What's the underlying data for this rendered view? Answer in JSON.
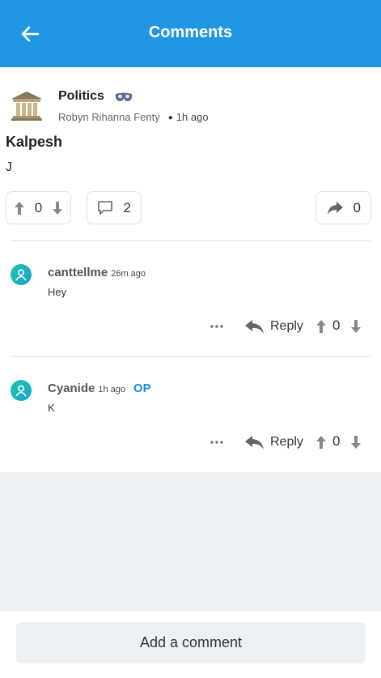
{
  "appbar": {
    "title": "Comments",
    "background": "#2196e3"
  },
  "post": {
    "community": "Politics",
    "author": "Robyn Rihanna Fenty",
    "time": "1h ago",
    "title": "Kalpesh",
    "body": "J",
    "score": "0",
    "comment_count": "2",
    "share_count": "0"
  },
  "comments": [
    {
      "author": "canttellme",
      "time": "26m ago",
      "text": "Hey",
      "is_op": false,
      "reply_label": "Reply",
      "score": "0"
    },
    {
      "author": "Cyanide",
      "time": "1h ago",
      "text": "K",
      "is_op": true,
      "op_label": "OP",
      "reply_label": "Reply",
      "score": "0"
    }
  ],
  "bottom": {
    "add_comment_label": "Add a comment"
  },
  "icons": {
    "back": "arrow-left-icon",
    "community": "building-columns-icon",
    "badge": "mask-icon",
    "upvote": "arrow-up-icon",
    "downvote": "arrow-down-icon",
    "comment": "speech-bubble-icon",
    "share": "share-arrow-icon",
    "more": "ellipsis-icon",
    "reply": "reply-arrow-icon",
    "avatar": "user-icon"
  },
  "colors": {
    "accent": "#2196e3",
    "op": "#1f8ad6",
    "background": "#eef1f4"
  }
}
